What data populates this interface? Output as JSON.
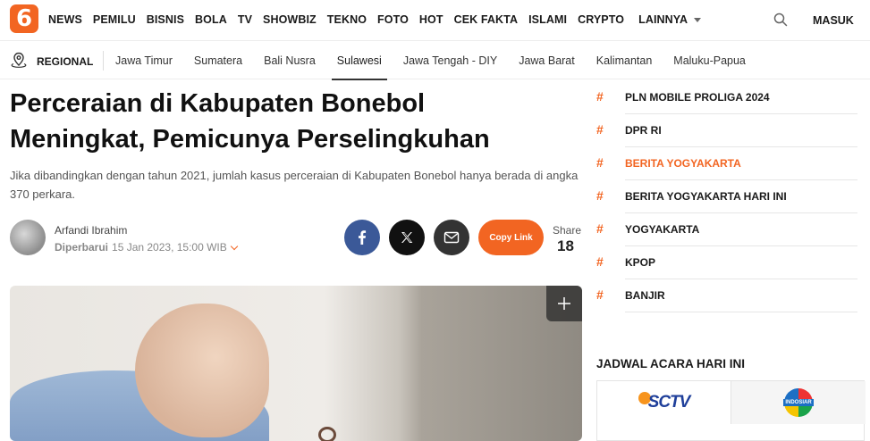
{
  "logo": {
    "text": "6"
  },
  "nav": {
    "items": [
      "NEWS",
      "PEMILU",
      "BISNIS",
      "BOLA",
      "TV",
      "SHOWBIZ",
      "TEKNO",
      "FOTO",
      "HOT",
      "CEK FAKTA",
      "ISLAMI",
      "CRYPTO"
    ],
    "more": "LAINNYA",
    "login": "MASUK"
  },
  "regional": {
    "label": "REGIONAL",
    "items": [
      "Jawa Timur",
      "Sumatera",
      "Bali Nusra",
      "Sulawesi",
      "Jawa Tengah - DIY",
      "Jawa Barat",
      "Kalimantan",
      "Maluku-Papua"
    ],
    "active": "Sulawesi"
  },
  "article": {
    "title": "Perceraian di Kabupaten Bonebol Meningkat, Pemicunya Perselingkuhan",
    "lede": "Jika dibandingkan dengan tahun 2021, jumlah kasus perceraian di Kabupaten Bonebol hanya berada di angka 370 perkara.",
    "author": "Arfandi Ibrahim",
    "updated_label": "Diperbarui",
    "updated_date": "15 Jan 2023, 15:00 WIB"
  },
  "share": {
    "copy_label": "Copy Link",
    "label": "Share",
    "count": "18"
  },
  "sidebar": {
    "tags": [
      {
        "label": "PLN MOBILE PROLIGA 2024",
        "highlight": false
      },
      {
        "label": "DPR RI",
        "highlight": false
      },
      {
        "label": "BERITA YOGYAKARTA",
        "highlight": true
      },
      {
        "label": "BERITA YOGYAKARTA HARI INI",
        "highlight": false
      },
      {
        "label": "YOGYAKARTA",
        "highlight": false
      },
      {
        "label": "KPOP",
        "highlight": false
      },
      {
        "label": "BANJIR",
        "highlight": false
      }
    ],
    "hash": "#",
    "schedule_title": "JADWAL ACARA HARI INI",
    "channels": [
      "SCTV",
      "INDOSIAR"
    ]
  },
  "colors": {
    "accent": "#f26522",
    "facebook": "#3b5998"
  }
}
